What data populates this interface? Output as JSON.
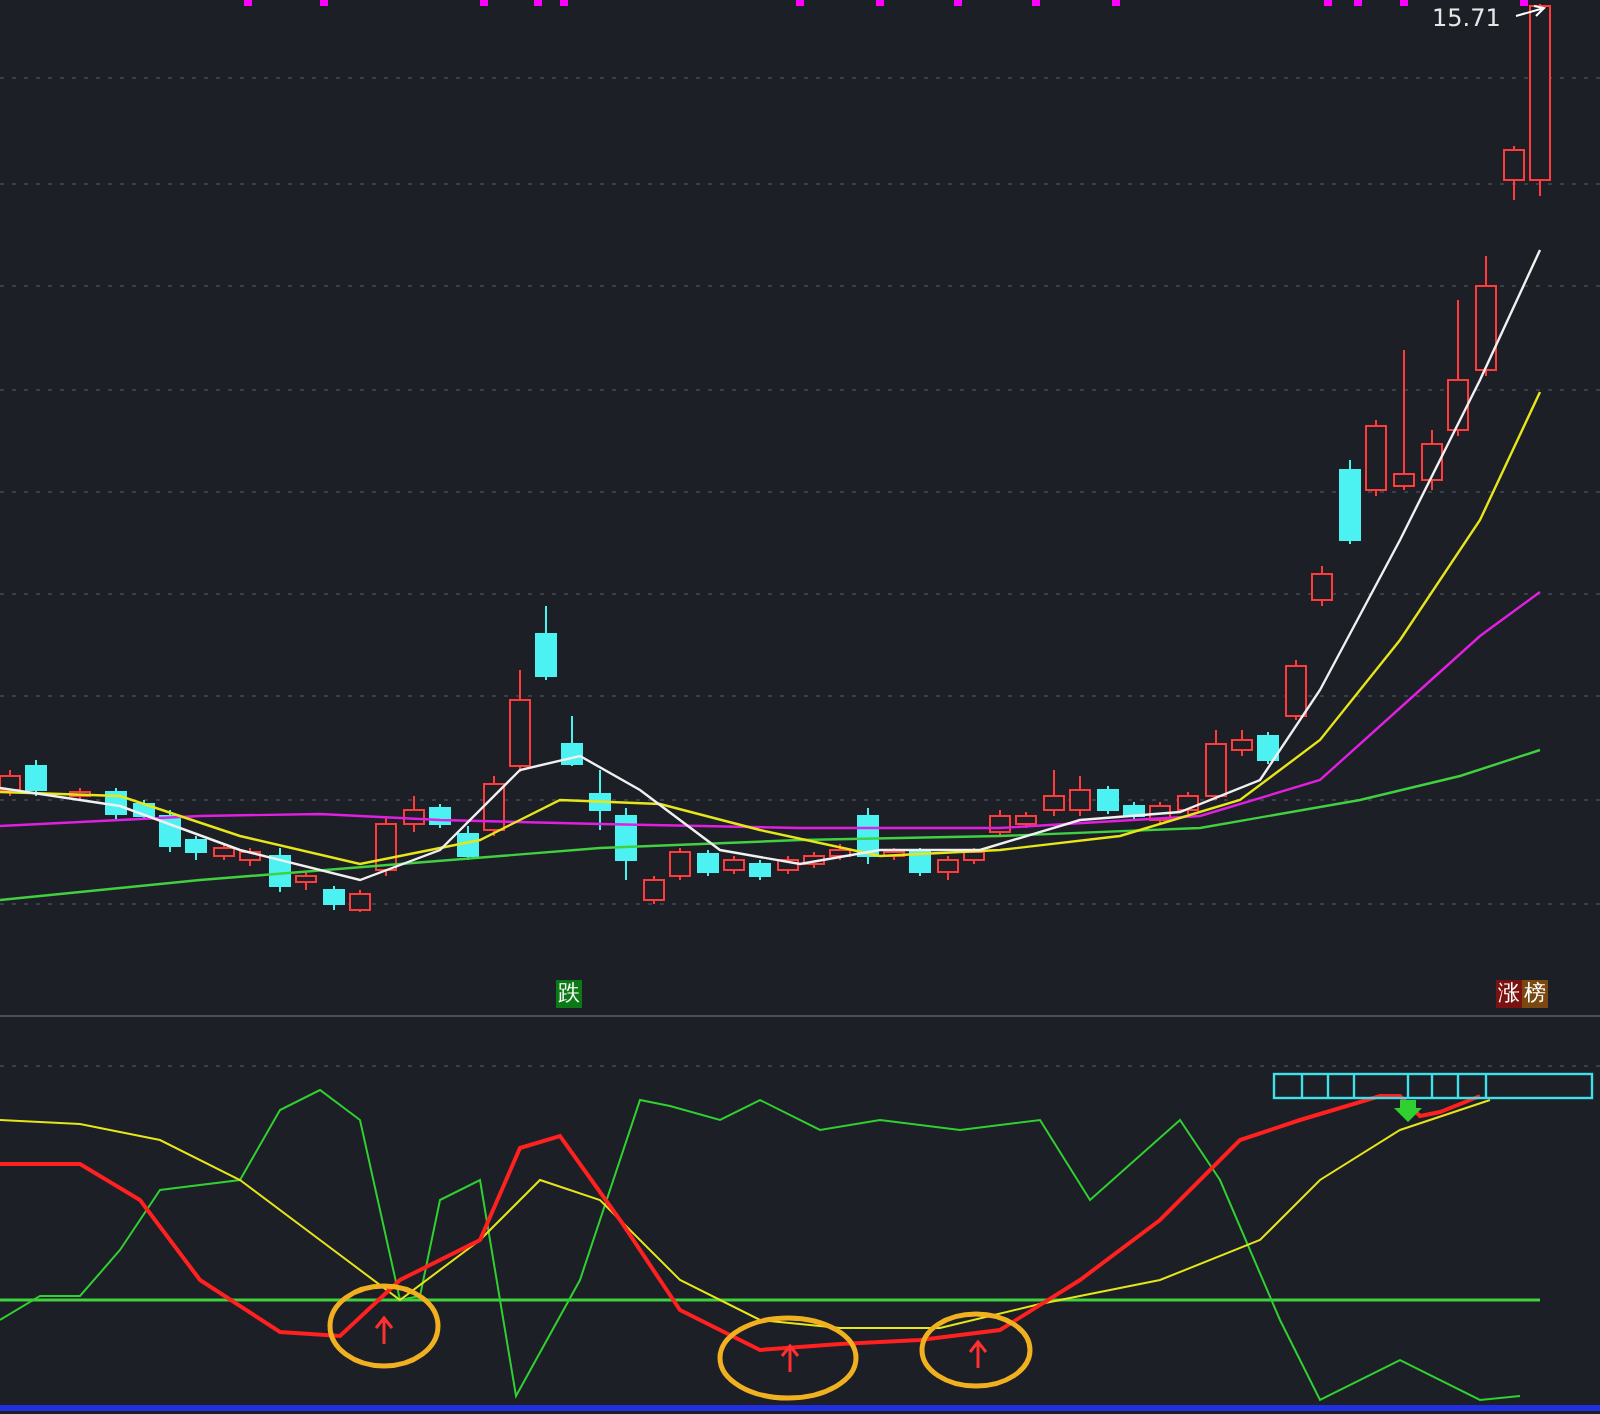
{
  "price_label": "15.71",
  "signal_badges": [
    {
      "label": "跌",
      "color": "#0b7a16"
    }
  ],
  "ranking_badges": [
    {
      "label": "涨",
      "color": "#7a1212"
    },
    {
      "label": "榜",
      "color": "#7a4810"
    }
  ]
}
